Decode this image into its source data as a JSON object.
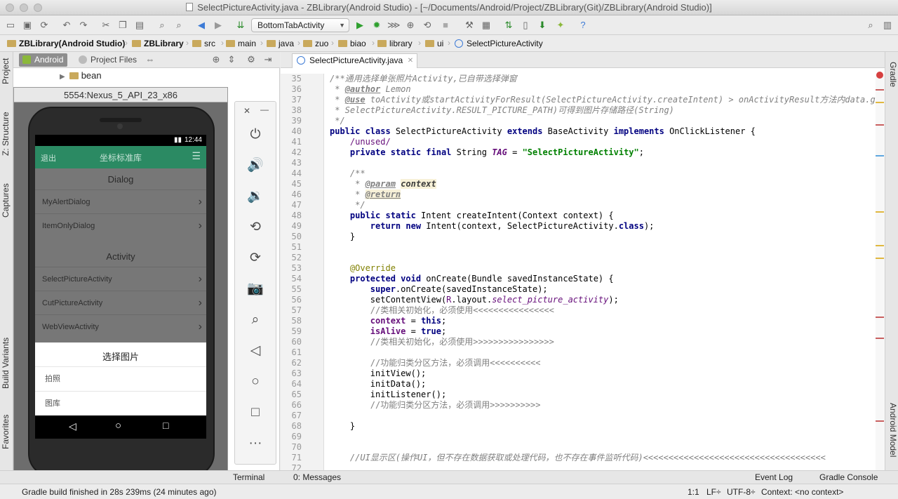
{
  "window": {
    "title": "SelectPictureActivity.java - ZBLibrary(Android Studio) - [~/Documents/Android/Project/ZBLibrary(Git)/ZBLibrary(Android Studio)]"
  },
  "toolbar": {
    "run_config": "BottomTabActivity"
  },
  "breadcrumbs": [
    "ZBLibrary(Android Studio)",
    "ZBLibrary",
    "src",
    "main",
    "java",
    "zuo",
    "biao",
    "library",
    "ui",
    "SelectPictureActivity"
  ],
  "left_strip": {
    "project": "Project",
    "structure": "Z: Structure",
    "captures": "Captures",
    "build_variants": "Build Variants",
    "favorites": "Favorites"
  },
  "right_strip": {
    "gradle": "Gradle",
    "android_model": "Android Model"
  },
  "project_panel": {
    "tab_android": "Android",
    "tab_project_files": "Project Files",
    "tree_item": "bean"
  },
  "emulator": {
    "title": "5554:Nexus_5_API_23_x86",
    "status_time": "12:44",
    "app_back": "退出",
    "app_title": "坐标标准库",
    "sections": [
      {
        "header": "Dialog",
        "items": [
          "MyAlertDialog",
          "ItemOnlyDialog"
        ]
      },
      {
        "header": "Activity",
        "items": [
          "SelectPictureActivity",
          "CutPictureActivity",
          "WebViewActivity"
        ]
      }
    ],
    "sheet": {
      "title": "选择图片",
      "option1": "拍照",
      "option2": "图库"
    }
  },
  "editor": {
    "tab": "SelectPictureActivity.java",
    "line_numbers": [
      "35",
      "36",
      "37",
      "38",
      "39",
      "40",
      "41",
      "42",
      "43",
      "44",
      "45",
      "46",
      "47",
      "48",
      "49",
      "50",
      "51",
      "52",
      "53",
      "54",
      "55",
      "56",
      "57",
      "58",
      "59",
      "60",
      "61",
      "62",
      "63",
      "64",
      "65",
      "66",
      "67",
      "68",
      "69",
      "70",
      "71",
      "72"
    ]
  },
  "bottom_tools": {
    "terminal": "Terminal",
    "messages": "0: Messages",
    "event_log": "Event Log",
    "gradle_console": "Gradle Console"
  },
  "status": {
    "message": "Gradle build finished in 28s 239ms (24 minutes ago)",
    "position": "1:1",
    "line_sep": "LF÷",
    "encoding": "UTF-8÷",
    "context": "Context: <no context>"
  },
  "colors": {
    "accent_green": "#2b8a63",
    "keyword": "#000080",
    "string": "#008000",
    "comment": "#808080",
    "field": "#660e7a"
  }
}
